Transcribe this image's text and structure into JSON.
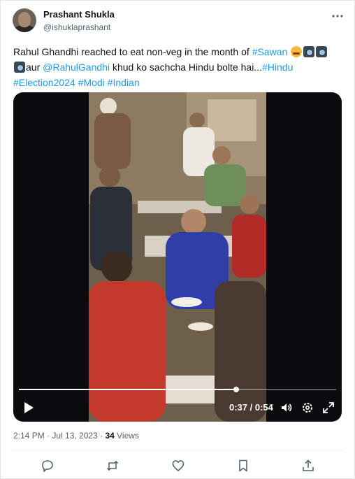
{
  "author": {
    "name": "Prashant Shukla",
    "handle": "@ishuklaprashant"
  },
  "more_icon": "more-dots-icon",
  "tweet": {
    "t1": "Rahul Ghandhi reached to eat non-veg in the month of ",
    "hashtag_sawan": "#Sawan",
    "emojis_line1": [
      "angry-face",
      "camera",
      "camera"
    ],
    "emoji_line2": "camera",
    "t2": "aur ",
    "mention": "@RahulGandhi",
    "t3": " khud ko sachcha Hindu bolte hai...",
    "hashtag_hindu": "#Hindu",
    "hashtag_election": "#Election2024",
    "hashtag_modi": "#Modi",
    "hashtag_indian": "#Indian"
  },
  "video": {
    "current_time": "0:37",
    "separator": " / ",
    "duration": "0:54",
    "progress": 0.685,
    "controls": [
      "play-icon",
      "volume-icon",
      "settings-icon",
      "fullscreen-icon"
    ]
  },
  "meta": {
    "time": "2:14 PM",
    "dot": " · ",
    "date": "Jul 13, 2023",
    "views_count": "34",
    "views_label": " Views"
  },
  "actions": [
    "reply-icon",
    "retweet-icon",
    "like-icon",
    "bookmark-icon",
    "share-icon"
  ],
  "colors": {
    "accent": "#1d9bf0",
    "text": "#0f1419",
    "secondary": "#536471"
  }
}
